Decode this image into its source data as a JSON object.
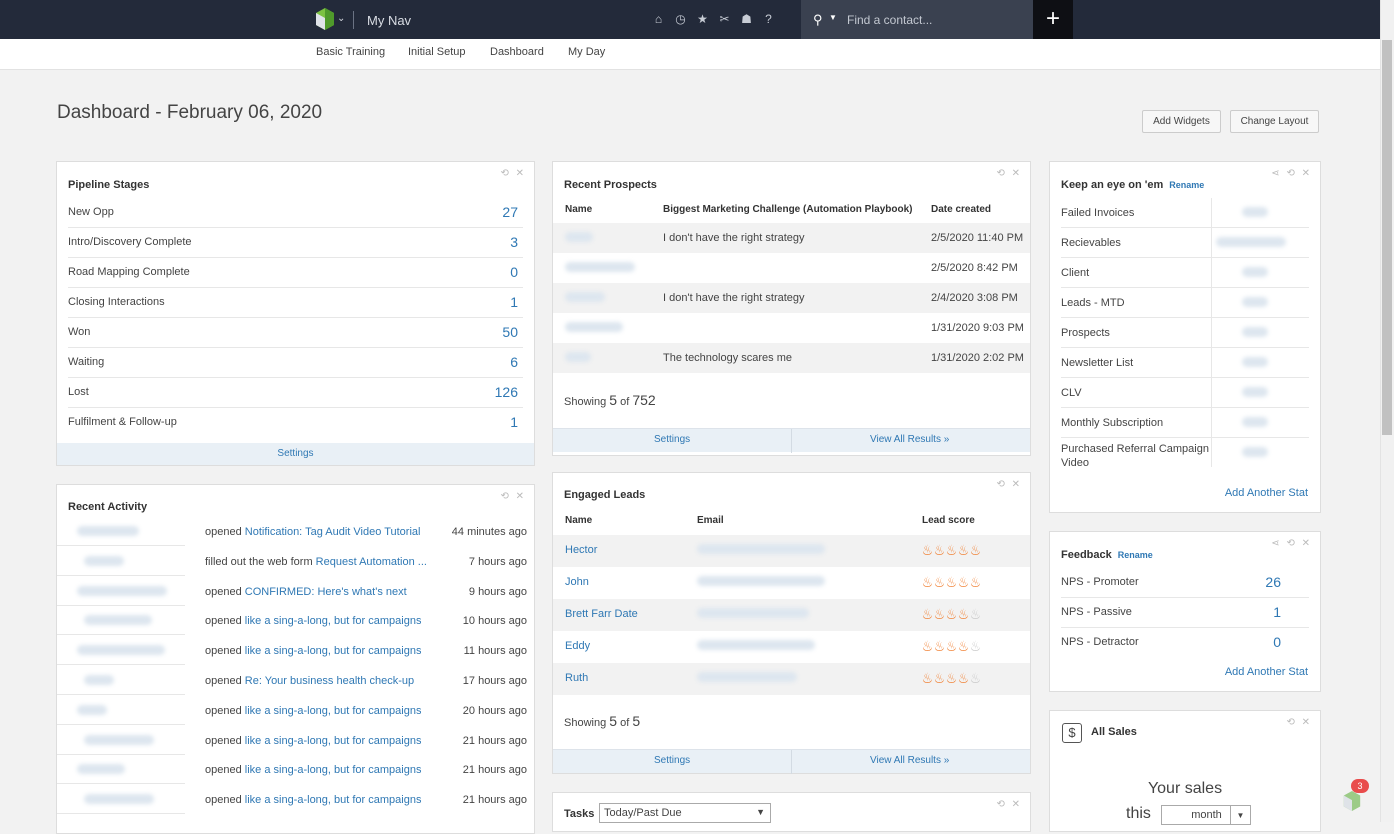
{
  "topbar": {
    "nav_label": "My Nav",
    "search_placeholder": "Find a contact...",
    "plus_label": "+",
    "icons": [
      "home-icon",
      "clock-icon",
      "star-icon",
      "tools-icon",
      "person-icon",
      "help-icon"
    ]
  },
  "subnav": [
    "Basic Training",
    "Initial Setup",
    "Dashboard",
    "My Day"
  ],
  "page": {
    "title": "Dashboard - February 06, 2020",
    "add_widgets": "Add Widgets",
    "change_layout": "Change Layout"
  },
  "pipeline": {
    "title": "Pipeline Stages",
    "settings": "Settings",
    "rows": [
      {
        "label": "New Opp",
        "value": "27"
      },
      {
        "label": "Intro/Discovery Complete",
        "value": "3"
      },
      {
        "label": "Road Mapping Complete",
        "value": "0"
      },
      {
        "label": "Closing Interactions",
        "value": "1"
      },
      {
        "label": "Won",
        "value": "50"
      },
      {
        "label": "Waiting",
        "value": "6"
      },
      {
        "label": "Lost",
        "value": "126"
      },
      {
        "label": "Fulfilment & Follow-up",
        "value": "1"
      }
    ]
  },
  "activity": {
    "title": "Recent Activity",
    "rows": [
      {
        "action": "opened ",
        "link": "Notification: Tag Audit Video Tutorial",
        "time": "44 minutes ago"
      },
      {
        "action": "filled out the web form ",
        "link": "Request Automation ...",
        "time": "7 hours ago"
      },
      {
        "action": "opened ",
        "link": "CONFIRMED: Here's what's next",
        "time": "9 hours ago"
      },
      {
        "action": "opened ",
        "link": "like a sing-a-long, but for campaigns",
        "time": "10 hours ago"
      },
      {
        "action": "opened ",
        "link": "like a sing-a-long, but for campaigns",
        "time": "11 hours ago"
      },
      {
        "action": "opened ",
        "link": "Re: Your business health check-up",
        "time": "17 hours ago"
      },
      {
        "action": "opened ",
        "link": "like a sing-a-long, but for campaigns",
        "time": "20 hours ago"
      },
      {
        "action": "opened ",
        "link": "like a sing-a-long, but for campaigns",
        "time": "21 hours ago"
      },
      {
        "action": "opened ",
        "link": "like a sing-a-long, but for campaigns",
        "time": "21 hours ago"
      },
      {
        "action": "opened ",
        "link": "like a sing-a-long, but for campaigns",
        "time": "21 hours ago"
      }
    ]
  },
  "prospects": {
    "title": "Recent Prospects",
    "columns": [
      "Name",
      "Biggest Marketing Challenge (Automation Playbook)",
      "Date created"
    ],
    "rows": [
      {
        "challenge": "I don't have the right strategy",
        "date": "2/5/2020 11:40 PM"
      },
      {
        "challenge": "",
        "date": "2/5/2020 8:42 PM"
      },
      {
        "challenge": "I don't have the right strategy",
        "date": "2/4/2020 3:08 PM"
      },
      {
        "challenge": "",
        "date": "1/31/2020 9:03 PM"
      },
      {
        "challenge": "The technology scares me",
        "date": "1/31/2020 2:02 PM"
      }
    ],
    "showing_prefix": "Showing ",
    "showing_count": "5",
    "showing_of": " of ",
    "showing_total": "752",
    "settings": "Settings",
    "view_all": "View All Results »"
  },
  "leads": {
    "title": "Engaged Leads",
    "columns": [
      "Name",
      "Email",
      "Lead score"
    ],
    "rows": [
      {
        "name": "Hector",
        "score": 5
      },
      {
        "name": "John",
        "score": 5
      },
      {
        "name": "Brett Farr Date",
        "score": 4
      },
      {
        "name": "Eddy",
        "score": 4
      },
      {
        "name": "Ruth",
        "score": 4
      }
    ],
    "max_score": 5,
    "showing_prefix": "Showing ",
    "showing_count": "5",
    "showing_of": " of ",
    "showing_total": "5",
    "settings": "Settings",
    "view_all": "View All Results »"
  },
  "tasks": {
    "title": "Tasks",
    "filter": "Today/Past Due"
  },
  "eye": {
    "title": "Keep an eye on 'em",
    "rename": "Rename",
    "rows": [
      "Failed Invoices",
      "Recievables",
      "Client",
      "Leads - MTD",
      "Prospects",
      "Newsletter List",
      "CLV",
      "Monthly Subscription",
      "Purchased Referral Campaign Video"
    ],
    "add_stat": "Add Another Stat"
  },
  "feedback": {
    "title": "Feedback",
    "rename": "Rename",
    "rows": [
      {
        "label": "NPS - Promoter",
        "value": "26"
      },
      {
        "label": "NPS - Passive",
        "value": "1"
      },
      {
        "label": "NPS - Detractor",
        "value": "0"
      }
    ],
    "add_stat": "Add Another Stat"
  },
  "sales": {
    "title": "All Sales",
    "your_sales": "Your sales",
    "this": "this",
    "period": "month"
  },
  "notif": {
    "count": "3"
  },
  "colors": {
    "topbar": "#232a3a",
    "link": "#2f78b4",
    "flame": "#f07b2a"
  }
}
